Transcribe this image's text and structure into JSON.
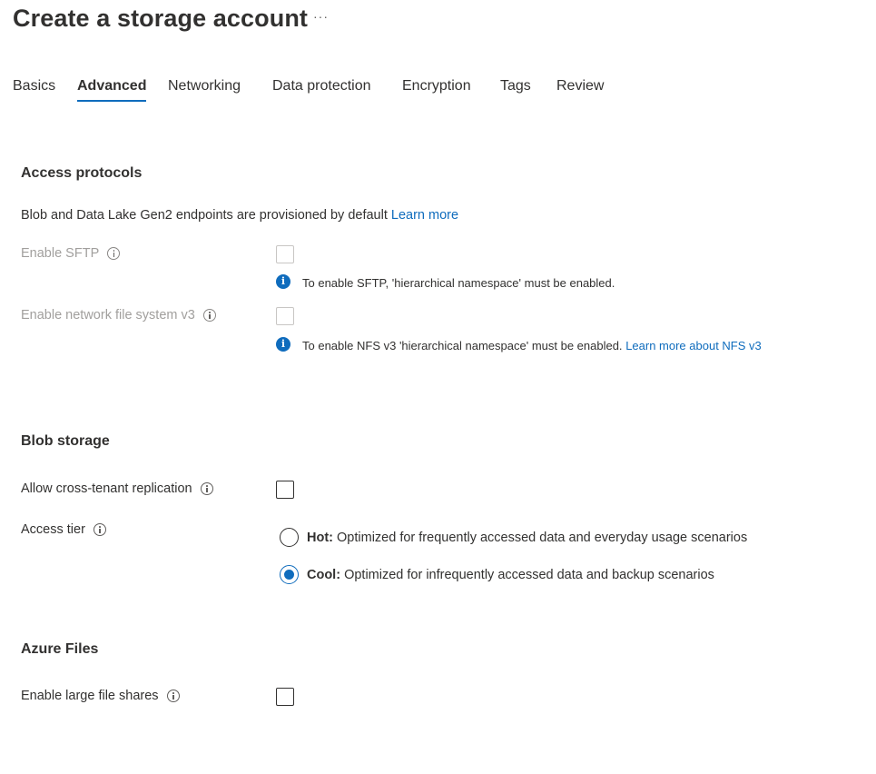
{
  "header": {
    "title": "Create a storage account",
    "more_label": "···"
  },
  "tabs": [
    {
      "label": "Basics",
      "active": false
    },
    {
      "label": "Advanced",
      "active": true
    },
    {
      "label": "Networking",
      "active": false
    },
    {
      "label": "Data protection",
      "active": false
    },
    {
      "label": "Encryption",
      "active": false
    },
    {
      "label": "Tags",
      "active": false
    },
    {
      "label": "Review",
      "active": false
    }
  ],
  "access_protocols": {
    "title": "Access protocols",
    "description": "Blob and Data Lake Gen2 endpoints are provisioned by default",
    "learn_more": "Learn more",
    "sftp": {
      "label": "Enable SFTP",
      "checked": false,
      "disabled": true,
      "notice": "To enable SFTP, 'hierarchical namespace' must be enabled."
    },
    "nfs": {
      "label": "Enable network file system v3",
      "checked": false,
      "disabled": true,
      "notice": "To enable NFS v3 'hierarchical namespace' must be enabled.",
      "notice_link": "Learn more about NFS v3"
    }
  },
  "blob_storage": {
    "title": "Blob storage",
    "cross_tenant": {
      "label": "Allow cross-tenant replication",
      "checked": false
    },
    "access_tier": {
      "label": "Access tier",
      "options": [
        {
          "name": "Hot:",
          "description": "Optimized for frequently accessed data and everyday usage scenarios",
          "selected": false
        },
        {
          "name": "Cool:",
          "description": "Optimized for infrequently accessed data and backup scenarios",
          "selected": true
        }
      ]
    }
  },
  "azure_files": {
    "title": "Azure Files",
    "large_file_shares": {
      "label": "Enable large file shares",
      "checked": false
    }
  },
  "colors": {
    "accent": "#0f6cbd",
    "text": "#323130",
    "disabled_text": "#a19f9d"
  }
}
